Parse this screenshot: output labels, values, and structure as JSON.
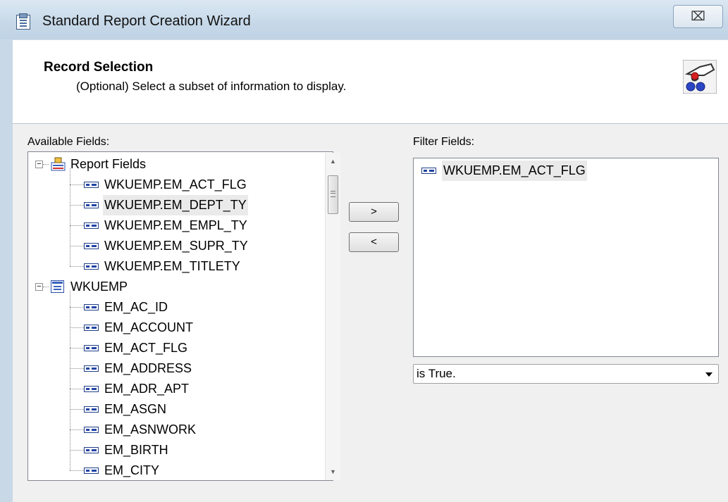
{
  "window": {
    "title": "Standard Report Creation Wizard",
    "close_glyph": "⌧"
  },
  "header": {
    "title": "Record Selection",
    "subtitle": "(Optional)  Select a subset of information to display.",
    "icon": "record-selection-wizard-icon"
  },
  "available": {
    "label": "Available Fields:",
    "groups": [
      {
        "name": "Report Fields",
        "icon": "report-fields-icon",
        "expanded": true,
        "items": [
          "WKUEMP.EM_ACT_FLG",
          "WKUEMP.EM_DEPT_TY",
          "WKUEMP.EM_EMPL_TY",
          "WKUEMP.EM_SUPR_TY",
          "WKUEMP.EM_TITLETY"
        ]
      },
      {
        "name": "WKUEMP",
        "icon": "table-icon",
        "expanded": true,
        "items": [
          "EM_AC_ID",
          "EM_ACCOUNT",
          "EM_ACT_FLG",
          "EM_ADDRESS",
          "EM_ADR_APT",
          "EM_ASGN",
          "EM_ASNWORK",
          "EM_BIRTH",
          "EM_CITY"
        ]
      }
    ],
    "highlighted_item": "WKUEMP.EM_DEPT_TY",
    "expander_glyph": "−"
  },
  "buttons": {
    "add": ">",
    "remove": "<"
  },
  "filter": {
    "label": "Filter Fields:",
    "items": [
      "WKUEMP.EM_ACT_FLG"
    ],
    "condition": "is True."
  },
  "colors": {
    "title_bar": "#c6d8e8",
    "dialog_body": "#f0f0f0",
    "selection": "#eaeaea",
    "field_icon": "#2244a4"
  }
}
